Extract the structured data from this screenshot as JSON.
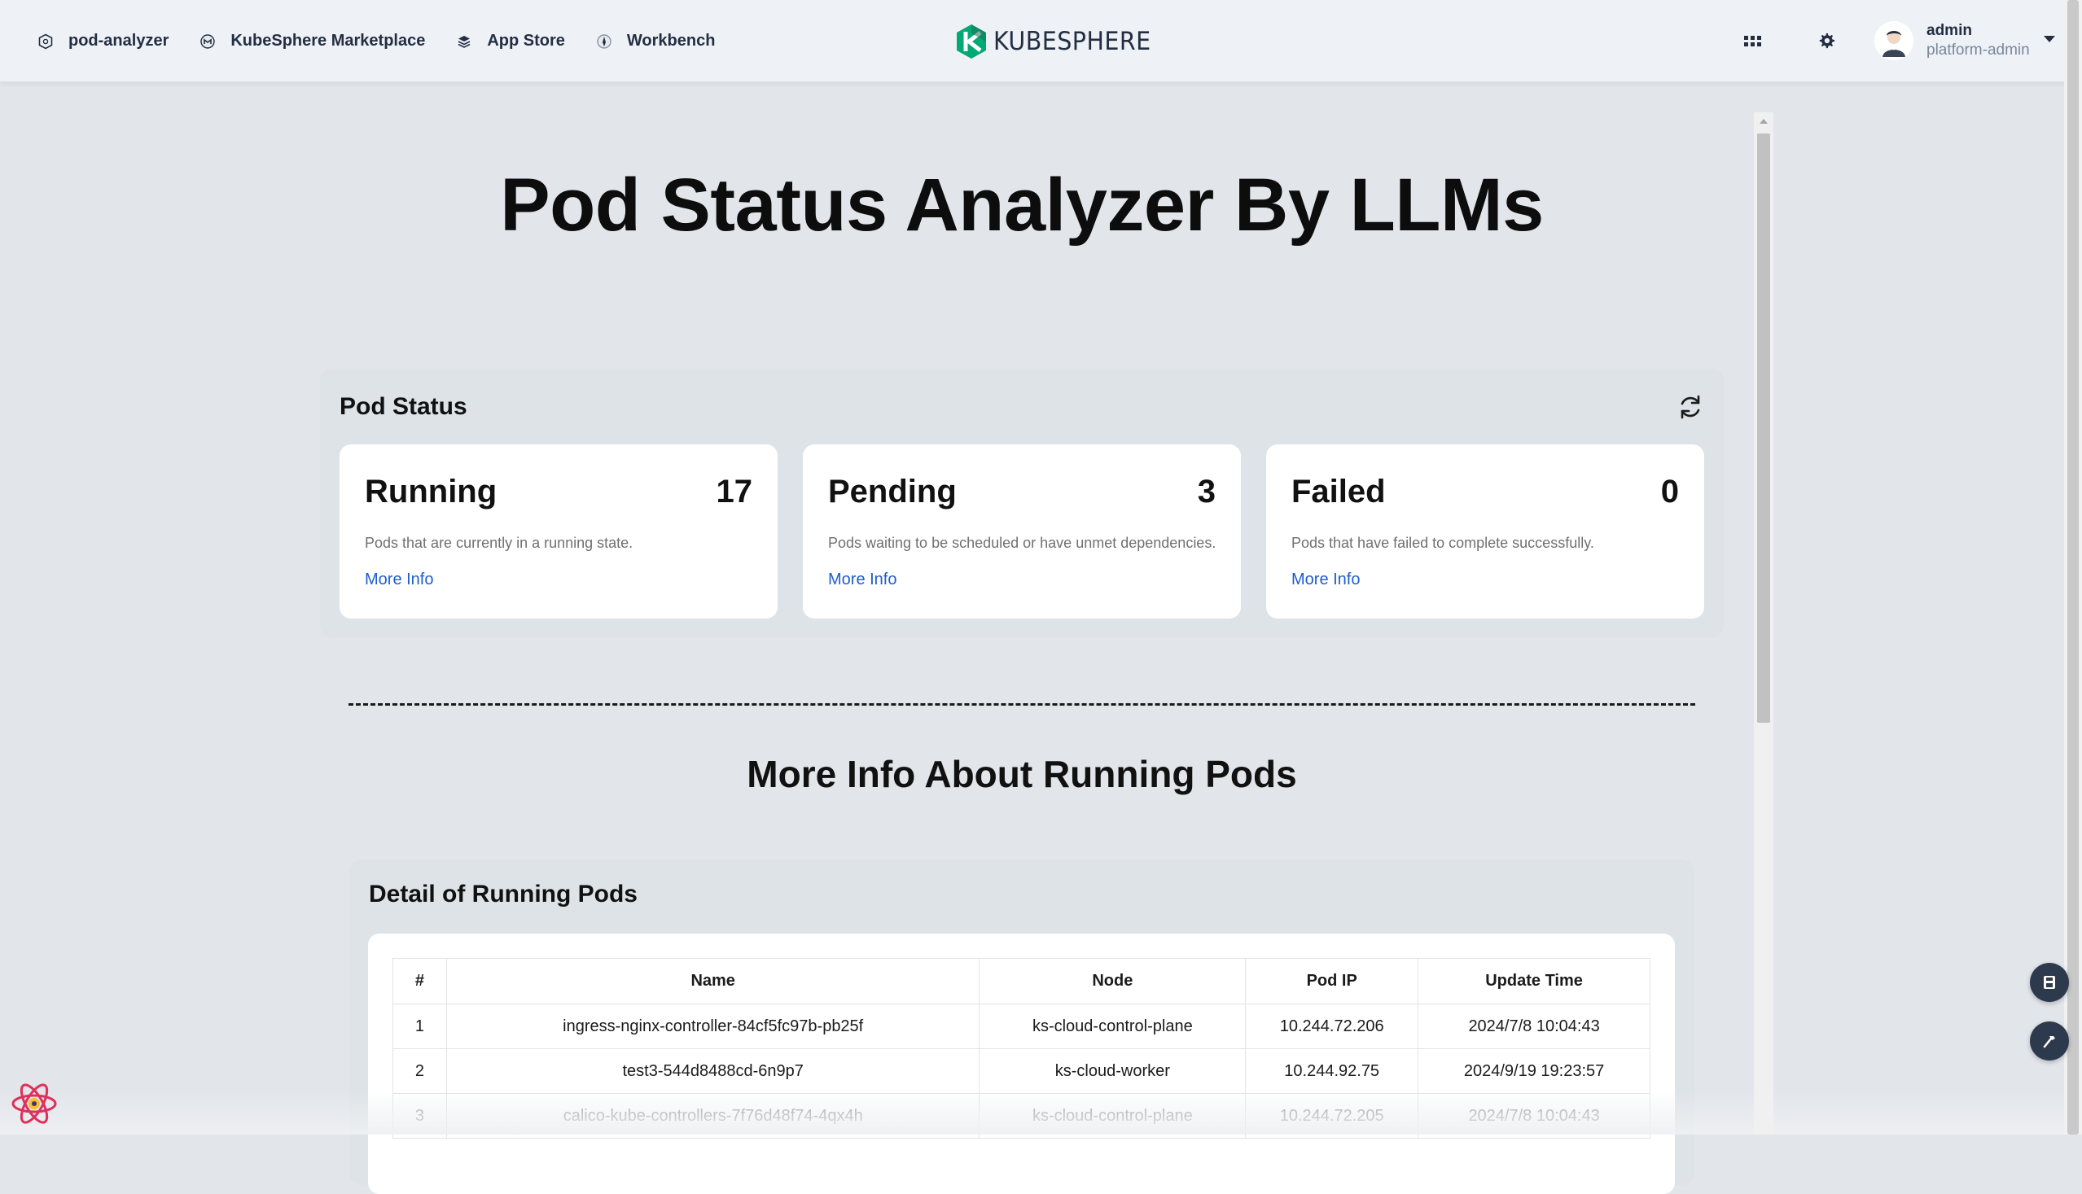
{
  "nav": {
    "links": [
      {
        "label": "pod-analyzer",
        "icon": "extension-icon"
      },
      {
        "label": "KubeSphere Marketplace",
        "icon": "marketplace-icon"
      },
      {
        "label": "App Store",
        "icon": "app-store-icon"
      },
      {
        "label": "Workbench",
        "icon": "workbench-icon"
      }
    ],
    "brand": "KUBESPHERE",
    "user": {
      "name": "admin",
      "role": "platform-admin"
    }
  },
  "page": {
    "title": "Pod Status Analyzer By LLMs"
  },
  "status_panel": {
    "title": "Pod Status",
    "cards": [
      {
        "title": "Running",
        "count": "17",
        "description": "Pods that are currently in a running state.",
        "link": "More Info"
      },
      {
        "title": "Pending",
        "count": "3",
        "description": "Pods waiting to be scheduled or have unmet dependencies.",
        "link": "More Info"
      },
      {
        "title": "Failed",
        "count": "0",
        "description": "Pods that have failed to complete successfully.",
        "link": "More Info"
      }
    ]
  },
  "section": {
    "title": "More Info About Running Pods"
  },
  "detail": {
    "title": "Detail of Running Pods",
    "columns": [
      "#",
      "Name",
      "Node",
      "Pod IP",
      "Update Time"
    ],
    "rows": [
      [
        "1",
        "ingress-nginx-controller-84cf5fc97b-pb25f",
        "ks-cloud-control-plane",
        "10.244.72.206",
        "2024/7/8 10:04:43"
      ],
      [
        "2",
        "test3-544d8488cd-6n9p7",
        "ks-cloud-worker",
        "10.244.92.75",
        "2024/9/19 19:23:57"
      ],
      [
        "3",
        "calico-kube-controllers-7f76d48f74-4qx4h",
        "ks-cloud-control-plane",
        "10.244.72.205",
        "2024/7/8 10:04:43"
      ]
    ]
  },
  "colors": {
    "accent_link": "#1e5dd0",
    "brand_green": "#00aa72",
    "background": "#e2e5ea"
  }
}
